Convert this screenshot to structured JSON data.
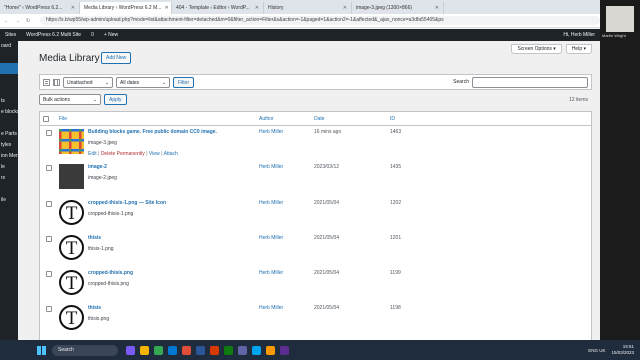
{
  "browser": {
    "tabs": [
      {
        "label": "\"Home\" ‹ WordPress 6.2...",
        "active": false
      },
      {
        "label": "Media Library ‹ WordPress 6.2 M...",
        "active": true
      },
      {
        "label": "404 - Template ‹ Editor ‹ WordP...",
        "active": false
      },
      {
        "label": "History",
        "active": false
      },
      {
        "label": "image-3.jpeg (1300×866)",
        "active": false
      }
    ],
    "url": "https://s.b/wp55/wp-admin/upload.php?mode=list&attachment-filter=detached&m=0&filter_action=Filter&s&action=-1&paged=1&action2=-1&affected&_ajax_nonce=a3dfa55405&ps"
  },
  "adminbar": {
    "items": [
      "Sites",
      "WordPress 6.2 Multi Site",
      "0",
      "+ New"
    ],
    "greeting": "Hi, Herb Miller"
  },
  "sidebar": {
    "items": [
      "oard",
      "",
      "",
      "ts",
      "e blocks",
      "",
      "e Parts",
      "tyles",
      "ion Menus",
      "le",
      "rs",
      "",
      "ile",
      ""
    ]
  },
  "header": {
    "screen_options": "Screen Options ▾",
    "help": "Help ▾",
    "title": "Media Library",
    "add_new": "Add New"
  },
  "filters": {
    "attachment_filter": "Unattached",
    "date_filter": "All dates",
    "filter_button": "Filter",
    "search_label": "Search"
  },
  "bulk": {
    "select": "Bulk actions",
    "apply": "Apply",
    "count": "12 items"
  },
  "columns": {
    "file": "File",
    "author": "Author",
    "date": "Date",
    "id": "ID"
  },
  "rows": [
    {
      "title": "Building blocks game. Free public domain CC0 image.",
      "filename": "image-3.jpeg",
      "author": "Herb Miller",
      "date": "16 mins ago",
      "id": "1463",
      "thumb": "blocks",
      "actions": {
        "edit": "Edit",
        "delete": "Delete Permanently",
        "view": "View",
        "attach": "Attach"
      }
    },
    {
      "title": "image-2",
      "filename": "image-2.jpeg",
      "author": "Herb Miller",
      "date": "2023/03/12",
      "id": "1435",
      "thumb": "dark"
    },
    {
      "title": "cropped-thisis-1.png — Site Icon",
      "filename": "cropped-thisis-1.png",
      "author": "Herb Miller",
      "date": "2021/05/04",
      "id": "1202",
      "thumb": "tee"
    },
    {
      "title": "thisis",
      "filename": "thisis-1.png",
      "author": "Herb Miller",
      "date": "2021/05/04",
      "id": "1201",
      "thumb": "tee"
    },
    {
      "title": "cropped-thisis.png",
      "filename": "cropped-thisis.png",
      "author": "Herb Miller",
      "date": "2021/05/04",
      "id": "1199",
      "thumb": "tee"
    },
    {
      "title": "thisis",
      "filename": "thisis.png",
      "author": "Herb Miller",
      "date": "2021/05/04",
      "id": "1198",
      "thumb": "tee"
    }
  ],
  "webcam": {
    "name": "Martin Wright"
  },
  "taskbar": {
    "search": "Search",
    "lang": "ENG\nUK",
    "time": "19:51",
    "date": "15/03/2023"
  }
}
